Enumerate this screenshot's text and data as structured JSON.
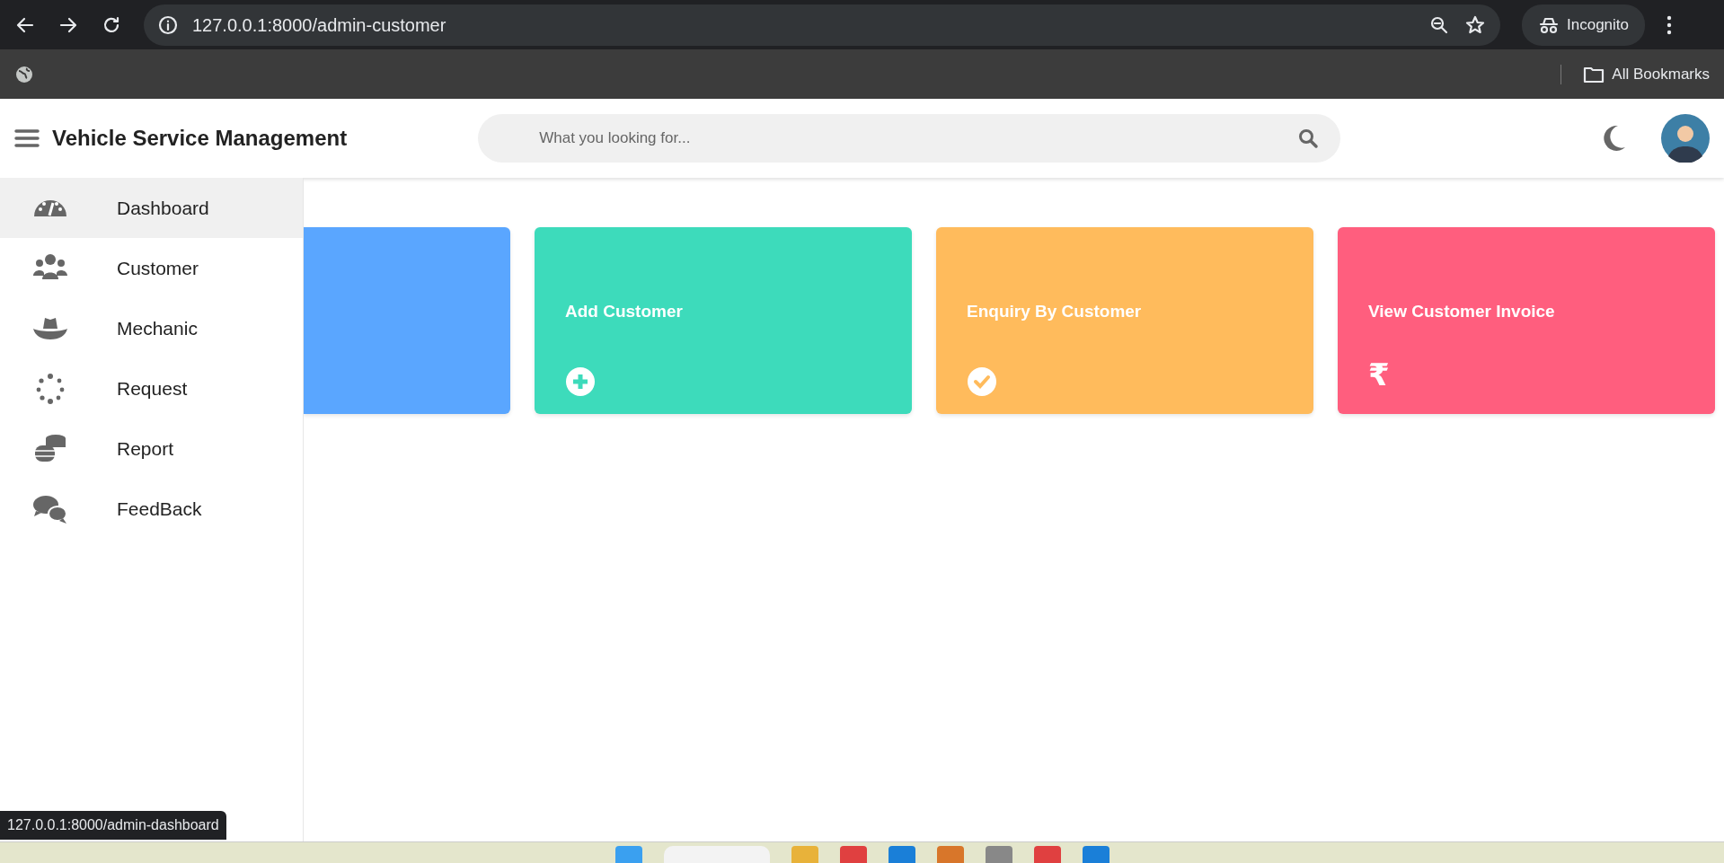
{
  "browser": {
    "url": "127.0.0.1:8000/admin-customer",
    "profile": "Incognito",
    "bookmarks": "All Bookmarks"
  },
  "header": {
    "title": "Vehicle Service Management",
    "search": {
      "placeholder": "What you looking for..."
    }
  },
  "sidebar": {
    "items": [
      {
        "label": "Dashboard",
        "selected": true
      },
      {
        "label": "Customer",
        "selected": false
      },
      {
        "label": "Mechanic",
        "selected": false
      },
      {
        "label": "Request",
        "selected": false
      },
      {
        "label": "Report",
        "selected": false
      },
      {
        "label": "FeedBack",
        "selected": false
      }
    ]
  },
  "cards": [
    {
      "kind": "hidden",
      "color": "#5aa6ff"
    },
    {
      "kind": "plus",
      "title": "Add Customer",
      "color": "#3ddbbb"
    },
    {
      "kind": "check",
      "title": "Enquiry By Customer",
      "color": "#ffbb5c"
    },
    {
      "kind": "symbol",
      "title": "View Customer Invoice",
      "symbol": "₹",
      "color": "#ff5e7e"
    }
  ],
  "status_bar": {
    "url": "127.0.0.1:8000/admin-dashboard"
  }
}
